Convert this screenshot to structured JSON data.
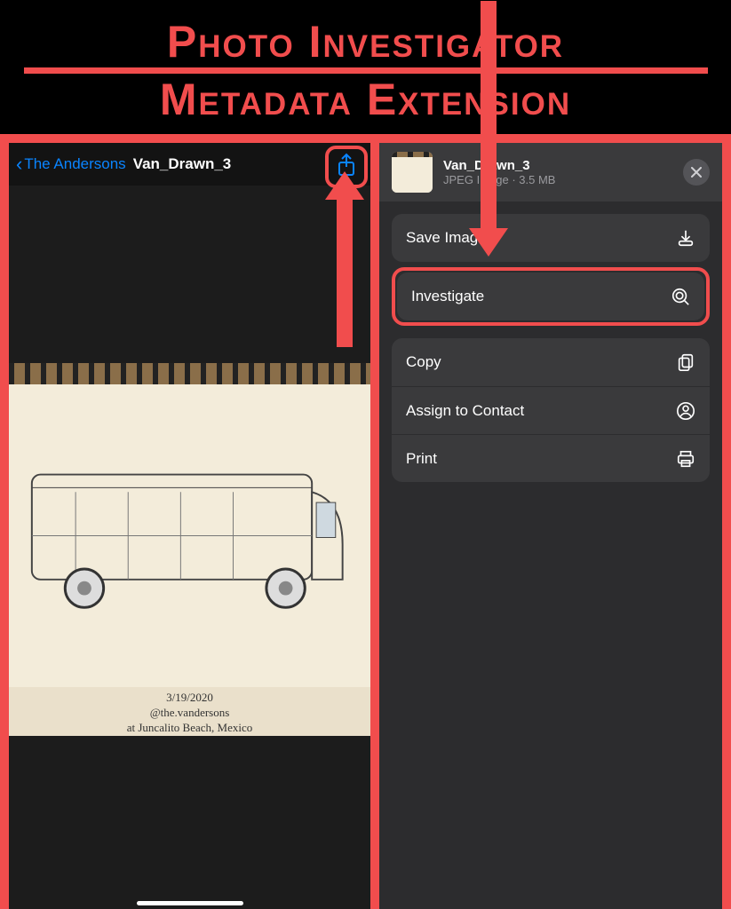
{
  "marketing": {
    "line1": "Photo Investigator",
    "line2": "Metadata Extension"
  },
  "leftPanel": {
    "backLabel": "The Andersons",
    "title": "Van_Drawn_3",
    "caption": {
      "date": "3/19/2020",
      "handle": "@the.vandersons",
      "location": "at Juncalito Beach, Mexico"
    }
  },
  "shareSheet": {
    "filename": "Van_Drawn_3",
    "filetype": "JPEG Image",
    "filesize": "3.5 MB",
    "actions": {
      "saveImage": "Save Image",
      "investigate": "Investigate",
      "copy": "Copy",
      "assignToContact": "Assign to Contact",
      "print": "Print"
    }
  }
}
